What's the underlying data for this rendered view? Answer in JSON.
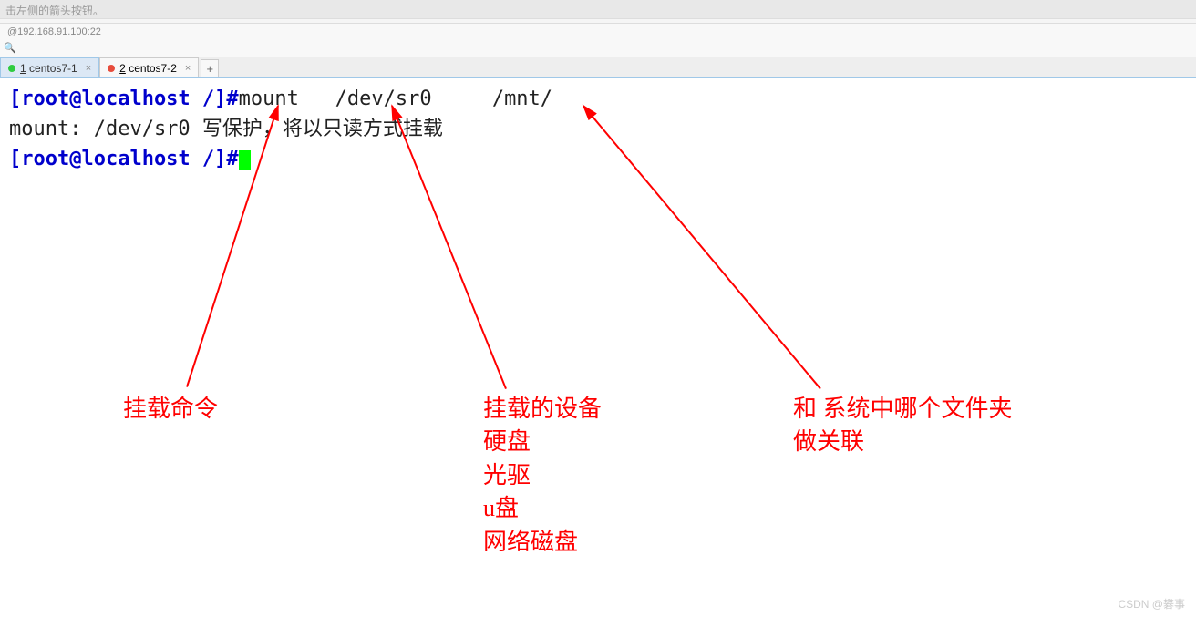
{
  "topHint": "击左侧的箭头按钮。",
  "address": "192.168.91.100:22",
  "searchIcon": "🔍",
  "tabs": [
    {
      "num": "1",
      "label": "centos7-1",
      "indicator": "green",
      "active": true
    },
    {
      "num": "2",
      "label": "centos7-2",
      "indicator": "red",
      "active": false
    }
  ],
  "addTab": "+",
  "terminal": {
    "line1": {
      "prompt": "[root@localhost /]#",
      "cmd": "mount   /dev/sr0     /mnt/"
    },
    "line2": "mount: /dev/sr0 写保护，将以只读方式挂载",
    "line3_prompt": "[root@localhost /]#"
  },
  "annotations": {
    "a1": "挂载命令",
    "a2_l1": "挂载的设备",
    "a2_l2": "硬盘",
    "a2_l3": "光驱",
    "a2_l4": "u盘",
    "a2_l5": "网络磁盘",
    "a3_l1": "和  系统中哪个文件夹",
    "a3_l2": "做关联"
  },
  "watermark": "CSDN @礬事"
}
